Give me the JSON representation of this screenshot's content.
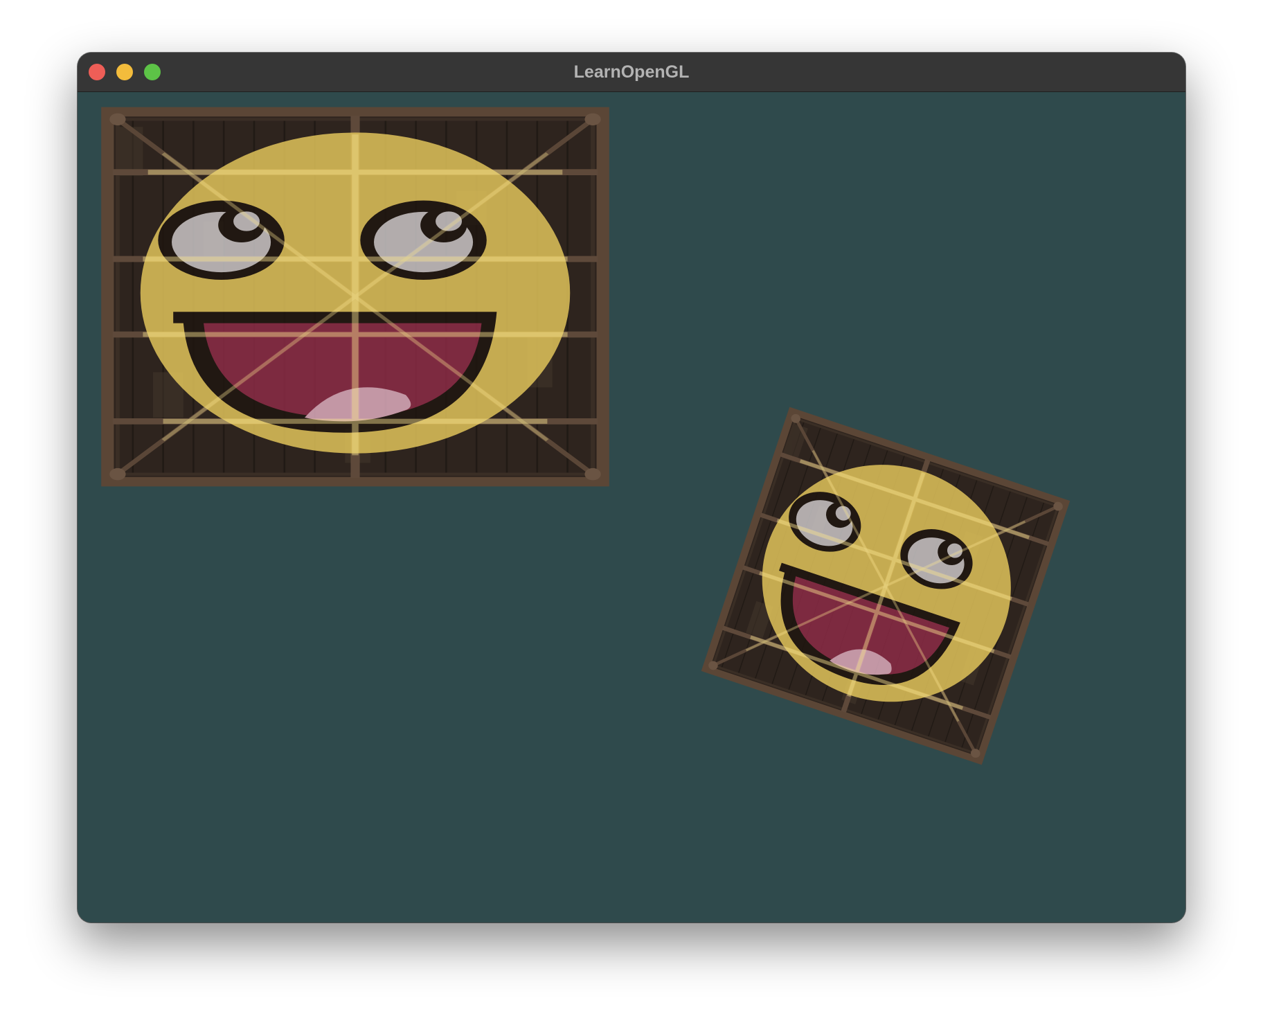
{
  "window": {
    "title": "LearnOpenGL"
  },
  "scene": {
    "background_color": "#2f4a4c",
    "quad_texture_base": "wooden-crate",
    "quad_texture_overlay": "awesome-face",
    "quads": [
      {
        "name": "static-quad",
        "rotation_deg": 0
      },
      {
        "name": "rotated-quad",
        "rotation_deg": 18.5
      }
    ]
  },
  "colors": {
    "close": "#ee5e57",
    "minimize": "#f3bc3c",
    "maximize": "#5dc347",
    "face_yellow": "#e7c95d",
    "mouth": "#8f2c48",
    "tongue": "#e4b1c3",
    "wood_dark": "#2e241e"
  }
}
